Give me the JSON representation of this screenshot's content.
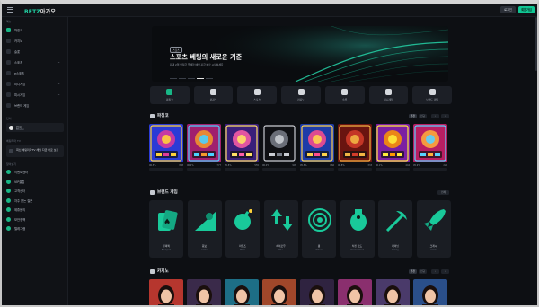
{
  "header": {
    "logo_main": "BETZ",
    "logo_accent": "아가오",
    "login_label": "로그인",
    "join_label": "회원가입"
  },
  "sidebar": {
    "section_main": "메뉴",
    "items": [
      {
        "label": "파칭코",
        "icon": "slot-icon",
        "accent": true
      },
      {
        "label": "카지노",
        "icon": "casino-icon"
      },
      {
        "label": "슬롯",
        "icon": "cards-icon"
      },
      {
        "label": "스포츠",
        "icon": "sports-icon",
        "expandable": true
      },
      {
        "label": "e스포츠",
        "icon": "esports-icon"
      },
      {
        "label": "미니게임",
        "icon": "minigame-icon",
        "expandable": true
      },
      {
        "label": "피시게임",
        "icon": "fish-icon",
        "expandable": true
      },
      {
        "label": "브랜드 게임",
        "icon": "brand-icon"
      }
    ],
    "section_lang": "언어",
    "language": {
      "name": "한국",
      "sub": "Korean"
    },
    "section_tv": "베팅리마 TV",
    "tv_text": "최신 베팅리마TV 채널 지금 바로 보기",
    "section_info": "알아보기",
    "info_items": [
      {
        "label": "이벤트센터",
        "icon": "gift-icon"
      },
      {
        "label": "VIP클럽",
        "icon": "crown-icon"
      },
      {
        "label": "고객센터",
        "icon": "headset-icon"
      },
      {
        "label": "자주 묻는 질문",
        "icon": "question-icon"
      },
      {
        "label": "제휴문의",
        "icon": "handshake-icon"
      },
      {
        "label": "보안정책",
        "icon": "shield-icon"
      },
      {
        "label": "텔레그램",
        "icon": "telegram-icon"
      }
    ]
  },
  "banner": {
    "badge": "스포츠",
    "title": "스포츠 베팅의 새로운 기준",
    "subtitle": "최대 2억 당첨금 무제한 배당 지금 바로 시작하세요"
  },
  "categories": [
    {
      "label": "파칭코",
      "icon": "slot-icon"
    },
    {
      "label": "카지노",
      "icon": "casino-icon"
    },
    {
      "label": "스포츠",
      "icon": "sports-icon"
    },
    {
      "label": "카지노",
      "icon": "chip-icon"
    },
    {
      "label": "슬롯",
      "icon": "cards-icon"
    },
    {
      "label": "미니게임",
      "icon": "minigame-icon"
    },
    {
      "label": "브랜드 게임",
      "icon": "brand-icon"
    }
  ],
  "section_slots": {
    "title": "파칭코",
    "tab_a": "추천",
    "tab_b": "신규"
  },
  "slots": [
    {
      "rtp": "96.5%",
      "num": "888"
    },
    {
      "rtp": "96.2%",
      "num": "777"
    },
    {
      "rtp": "95.8%",
      "num": "555"
    },
    {
      "rtp": "96.0%",
      "num": "999"
    },
    {
      "rtp": "95.5%",
      "num": "666"
    },
    {
      "rtp": "96.8%",
      "num": "333"
    },
    {
      "rtp": "96.1%",
      "num": "444"
    },
    {
      "rtp": "95.9%",
      "num": "222"
    }
  ],
  "section_brand": {
    "title": "브랜드 게임",
    "all": "전체"
  },
  "brands": [
    {
      "label": "블랙잭",
      "sub": "Blackjack"
    },
    {
      "label": "림보",
      "sub": "Limbo"
    },
    {
      "label": "마인즈",
      "sub": "Mines"
    },
    {
      "label": "하이로우",
      "sub": "HiLo"
    },
    {
      "label": "휠",
      "sub": "Wheel"
    },
    {
      "label": "치킨 로드",
      "sub": "Chicken Road"
    },
    {
      "label": "마이닝",
      "sub": "Mining"
    },
    {
      "label": "크래시",
      "sub": "Crash"
    }
  ],
  "section_casino": {
    "title": "카지노",
    "tab_a": "추천",
    "tab_b": "신규"
  },
  "colors": {
    "accent": "#11c794",
    "bg": "#0d0f13",
    "panel": "#1a1d23"
  }
}
